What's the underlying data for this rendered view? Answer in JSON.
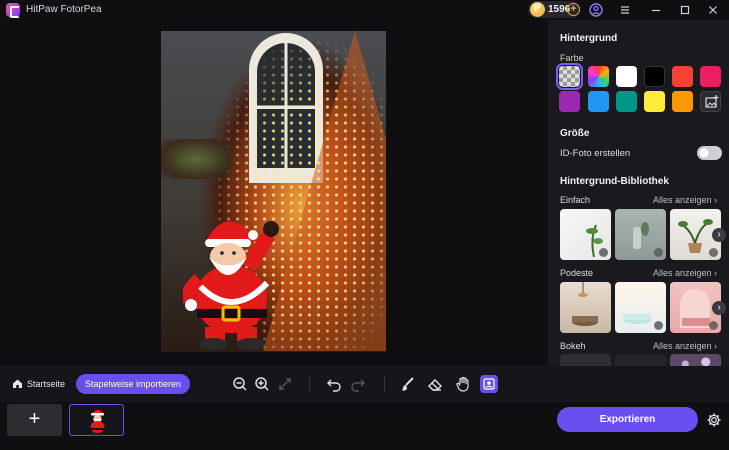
{
  "window": {
    "title": "HitPaw FotorPea",
    "credits": "1596"
  },
  "panel": {
    "background_title": "Hintergrund",
    "color_label": "Farbe",
    "colors": [
      "transparent",
      "rainbow",
      "#ffffff",
      "#000000",
      "#f44336",
      "#e91e63",
      "#9c27b0",
      "#2196f3",
      "#009688",
      "#ffeb3b",
      "#ff9800"
    ],
    "size_title": "Größe",
    "id_photo_label": "ID-Foto erstellen",
    "id_photo_enabled": false,
    "library_title": "Hintergrund-Bibliothek",
    "categories": [
      {
        "name": "Einfach",
        "see_all": "Alles anzeigen"
      },
      {
        "name": "Podeste",
        "see_all": "Alles anzeigen"
      },
      {
        "name": "Bokeh",
        "see_all": "Alles anzeigen"
      }
    ]
  },
  "toolbar": {
    "home_label": "Startseite",
    "batch_import_label": "Stapelweise importieren"
  },
  "footer": {
    "export_label": "Exportieren",
    "accent": "#6b4ef0"
  }
}
